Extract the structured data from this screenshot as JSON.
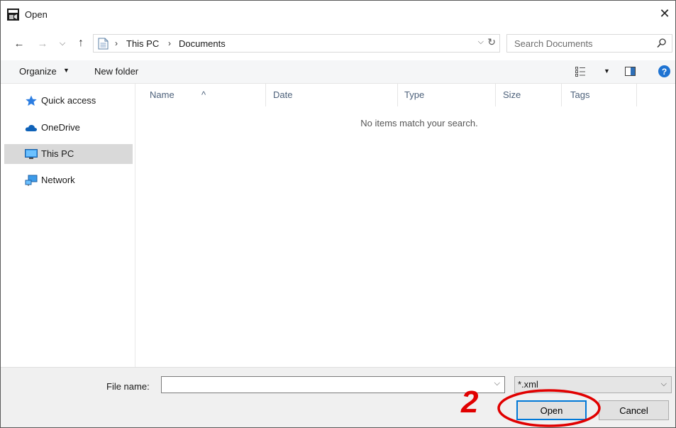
{
  "window": {
    "title": "Open",
    "close_glyph": "✕"
  },
  "nav": {
    "back_glyph": "←",
    "forward_glyph": "→",
    "recent_glyph": "⌵",
    "up_glyph": "↑",
    "breadcrumb": [
      "This PC",
      "Documents"
    ],
    "crumb_separator": "›",
    "dropdown_glyph": "⌵",
    "refresh_glyph": "↻",
    "search_placeholder": "Search Documents"
  },
  "toolbar": {
    "organize_label": "Organize",
    "organize_caret": "▼",
    "new_folder_label": "New folder",
    "view_caret": "▼",
    "help_label": "?"
  },
  "sidebar": {
    "items": [
      {
        "label": "Quick access",
        "icon": "star-icon",
        "selected": false
      },
      {
        "label": "OneDrive",
        "icon": "cloud-icon",
        "selected": false
      },
      {
        "label": "This PC",
        "icon": "computer-icon",
        "selected": true
      },
      {
        "label": "Network",
        "icon": "network-icon",
        "selected": false
      }
    ]
  },
  "filelist": {
    "columns": [
      "Name",
      "Date",
      "Type",
      "Size",
      "Tags"
    ],
    "sort_glyph": "^",
    "empty_message": "No items match your search."
  },
  "footer": {
    "file_name_label": "File name:",
    "file_name_value": "",
    "dropdown_glyph": "⌵",
    "file_type_filter": "*.xml",
    "open_label": "Open",
    "cancel_label": "Cancel"
  },
  "annotation": {
    "step_number": "2",
    "color": "#e10000"
  },
  "colors": {
    "accent": "#0078d7",
    "help": "#1e73d2",
    "selection": "#d9d9d9"
  }
}
